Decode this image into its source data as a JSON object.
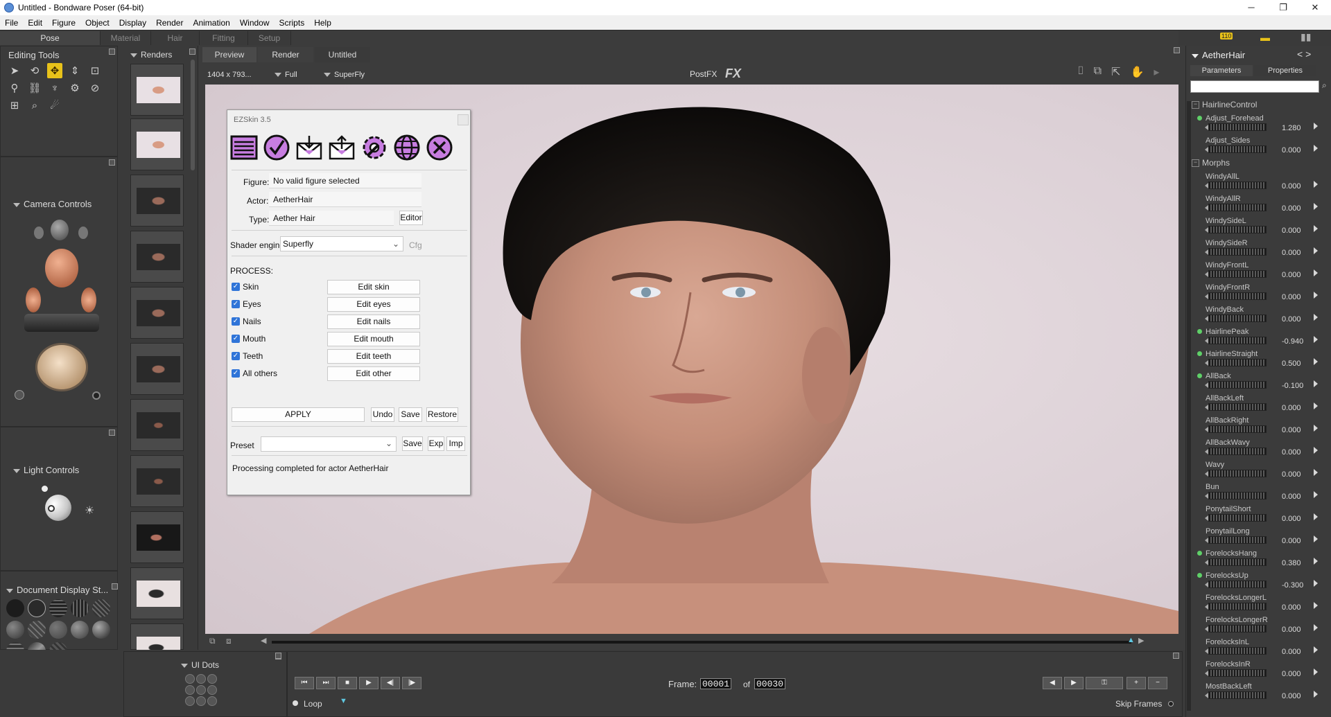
{
  "window": {
    "title": "Untitled - Bondware Poser (64-bit)",
    "minimize": "─",
    "maximize": "❐",
    "close": "✕"
  },
  "menu": [
    "File",
    "Edit",
    "Figure",
    "Object",
    "Display",
    "Render",
    "Animation",
    "Window",
    "Scripts",
    "Help"
  ],
  "rooms": [
    "Pose",
    "Material",
    "Hair",
    "Fitting",
    "Setup"
  ],
  "editing_tools": {
    "title": "Editing Tools"
  },
  "camera_controls": {
    "title": "Camera Controls"
  },
  "light_controls": {
    "title": "Light Controls"
  },
  "document_display": {
    "title": "Document Display St..."
  },
  "ui_dots": {
    "title": "UI Dots"
  },
  "renders": {
    "title": "Renders"
  },
  "document": {
    "tabs": [
      "Preview",
      "Render",
      "Untitled"
    ],
    "size": "1404 x 793...",
    "view": "Full",
    "engine": "SuperFly",
    "postfx": "PostFX",
    "fx": "FX"
  },
  "ezskin": {
    "title": "EZSkin 3.5",
    "figure_label": "Figure:",
    "figure_value": "No valid figure selected",
    "actor_label": "Actor:",
    "actor_value": "AetherHair",
    "type_label": "Type:",
    "type_value": "Aether Hair",
    "editor_btn": "Editor",
    "shader_label": "Shader engine:",
    "shader_value": "Superfly",
    "cfg_btn": "Cfg",
    "process_label": "PROCESS:",
    "process": [
      {
        "check": "Skin",
        "button": "Edit skin"
      },
      {
        "check": "Eyes",
        "button": "Edit eyes"
      },
      {
        "check": "Nails",
        "button": "Edit nails"
      },
      {
        "check": "Mouth",
        "button": "Edit mouth"
      },
      {
        "check": "Teeth",
        "button": "Edit teeth"
      },
      {
        "check": "All others",
        "button": "Edit other"
      }
    ],
    "apply_btn": "APPLY",
    "undo_btn": "Undo",
    "save_btn": "Save",
    "restore_btn": "Restore",
    "preset_label": "Preset",
    "preset_save": "Save",
    "preset_exp": "Exp",
    "preset_imp": "Imp",
    "status": "Processing completed for actor AetherHair"
  },
  "params": {
    "actor": "AetherHair",
    "tab_parameters": "Parameters",
    "tab_properties": "Properties",
    "nav": "< >",
    "groups": [
      {
        "name": "HairlineControl",
        "items": [
          {
            "name": "Adjust_Forehead",
            "value": "1.280",
            "dot": true
          },
          {
            "name": "Adjust_Sides",
            "value": "0.000",
            "dot": false
          }
        ]
      },
      {
        "name": "Morphs",
        "items": [
          {
            "name": "WindyAllL",
            "value": "0.000",
            "dot": false
          },
          {
            "name": "WindyAllR",
            "value": "0.000",
            "dot": false
          },
          {
            "name": "WindySideL",
            "value": "0.000",
            "dot": false
          },
          {
            "name": "WindySideR",
            "value": "0.000",
            "dot": false
          },
          {
            "name": "WindyFrontL",
            "value": "0.000",
            "dot": false
          },
          {
            "name": "WindyFrontR",
            "value": "0.000",
            "dot": false
          },
          {
            "name": "WindyBack",
            "value": "0.000",
            "dot": false
          },
          {
            "name": "HairlinePeak",
            "value": "-0.940",
            "dot": true
          },
          {
            "name": "HairlineStraight",
            "value": "0.500",
            "dot": true
          },
          {
            "name": "AllBack",
            "value": "-0.100",
            "dot": true
          },
          {
            "name": "AllBackLeft",
            "value": "0.000",
            "dot": false
          },
          {
            "name": "AllBackRight",
            "value": "0.000",
            "dot": false
          },
          {
            "name": "AllBackWavy",
            "value": "0.000",
            "dot": false
          },
          {
            "name": "Wavy",
            "value": "0.000",
            "dot": false
          },
          {
            "name": "Bun",
            "value": "0.000",
            "dot": false
          },
          {
            "name": "PonytailShort",
            "value": "0.000",
            "dot": false
          },
          {
            "name": "PonytailLong",
            "value": "0.000",
            "dot": false
          },
          {
            "name": "ForelocksHang",
            "value": "0.380",
            "dot": true
          },
          {
            "name": "ForelocksUp",
            "value": "-0.300",
            "dot": true
          },
          {
            "name": "ForelocksLongerL",
            "value": "0.000",
            "dot": false
          },
          {
            "name": "ForelocksLongerR",
            "value": "0.000",
            "dot": false
          },
          {
            "name": "ForelocksInL",
            "value": "0.000",
            "dot": false
          },
          {
            "name": "ForelocksInR",
            "value": "0.000",
            "dot": false
          },
          {
            "name": "MostBackLeft",
            "value": "0.000",
            "dot": false
          }
        ]
      }
    ]
  },
  "animation": {
    "frame_label": "Frame:",
    "frame_value": "00001",
    "of_label": "of",
    "total_frames": "00030",
    "loop_label": "Loop",
    "skip_frames_label": "Skip Frames",
    "badge_count": "110"
  }
}
